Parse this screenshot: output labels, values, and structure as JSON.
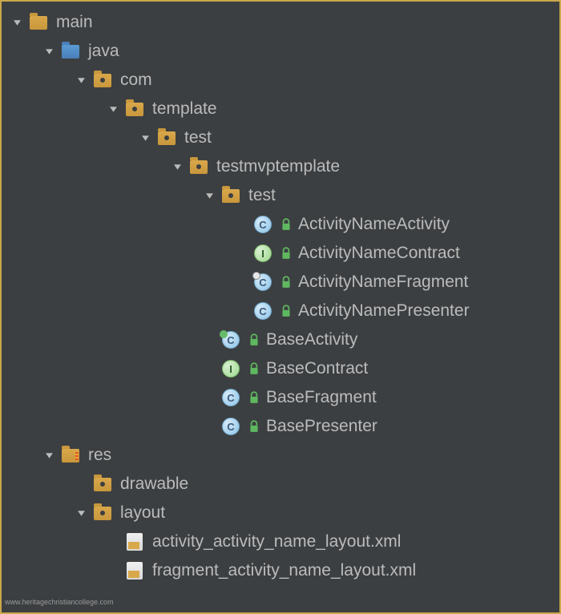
{
  "tree": {
    "main": "main",
    "java": "java",
    "com": "com",
    "template": "template",
    "test1": "test",
    "testmvp": "testmvptemplate",
    "test2": "test",
    "activityNameActivity": "ActivityNameActivity",
    "activityNameContract": "ActivityNameContract",
    "activityNameFragment": "ActivityNameFragment",
    "activityNamePresenter": "ActivityNamePresenter",
    "baseActivity": "BaseActivity",
    "baseContract": "BaseContract",
    "baseFragment": "BaseFragment",
    "basePresenter": "BasePresenter",
    "res": "res",
    "drawable": "drawable",
    "layout": "layout",
    "activityLayoutXml": "activity_activity_name_layout.xml",
    "fragmentLayoutXml": "fragment_activity_name_layout.xml"
  },
  "watermark": "www.heritagechristiancollege.com"
}
